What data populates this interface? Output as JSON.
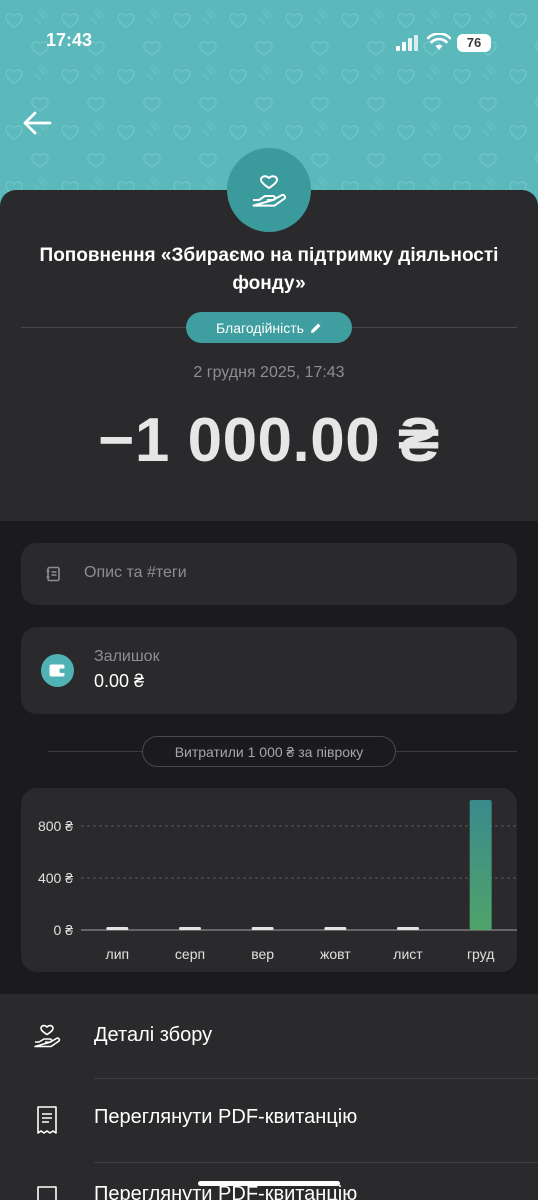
{
  "status_bar": {
    "time": "17:43",
    "battery": "76"
  },
  "header": {
    "back_icon": "arrow-left-icon",
    "hero_icon": "heart-hand-icon"
  },
  "title": "Поповнення «Збираємо на підтримку діяльності фонду»",
  "category": {
    "label": "Благодійність",
    "icon": "pencil-icon"
  },
  "date": "2 грудня 2025, 17:43",
  "amount": "−1 000.00 ₴",
  "description": {
    "placeholder": "Опис та #теги",
    "icon": "notebook-icon"
  },
  "balance": {
    "label": "Залишок",
    "value": "0.00 ₴",
    "icon": "wallet-icon"
  },
  "spent_summary": "Витратили 1 000 ₴ за півроку",
  "chart_data": {
    "type": "bar",
    "categories": [
      "лип",
      "серп",
      "вер",
      "жовт",
      "лист",
      "груд"
    ],
    "values": [
      0,
      0,
      0,
      0,
      0,
      1000
    ],
    "y_ticks": [
      "800 ₴",
      "400 ₴",
      "0 ₴"
    ],
    "y_tick_values": [
      800,
      400,
      0
    ],
    "ylim": [
      0,
      1000
    ],
    "grid": true,
    "bar_colors": {
      "inactive": "#e3e3e3",
      "active_top": "#3a8a8c",
      "active_bottom": "#4fa36a"
    }
  },
  "menu": [
    {
      "label": "Деталі збору",
      "icon": "heart-hand-icon"
    },
    {
      "label": "Переглянути PDF-квитанцію",
      "icon": "receipt-icon"
    },
    {
      "label": "Переглянути PDF-квитанцію",
      "icon": "receipt-icon"
    }
  ],
  "colors": {
    "accent": "#3e9ea0",
    "header": "#5bb8bb",
    "background": "#1b1b1d",
    "card": "#2a2a2c"
  }
}
